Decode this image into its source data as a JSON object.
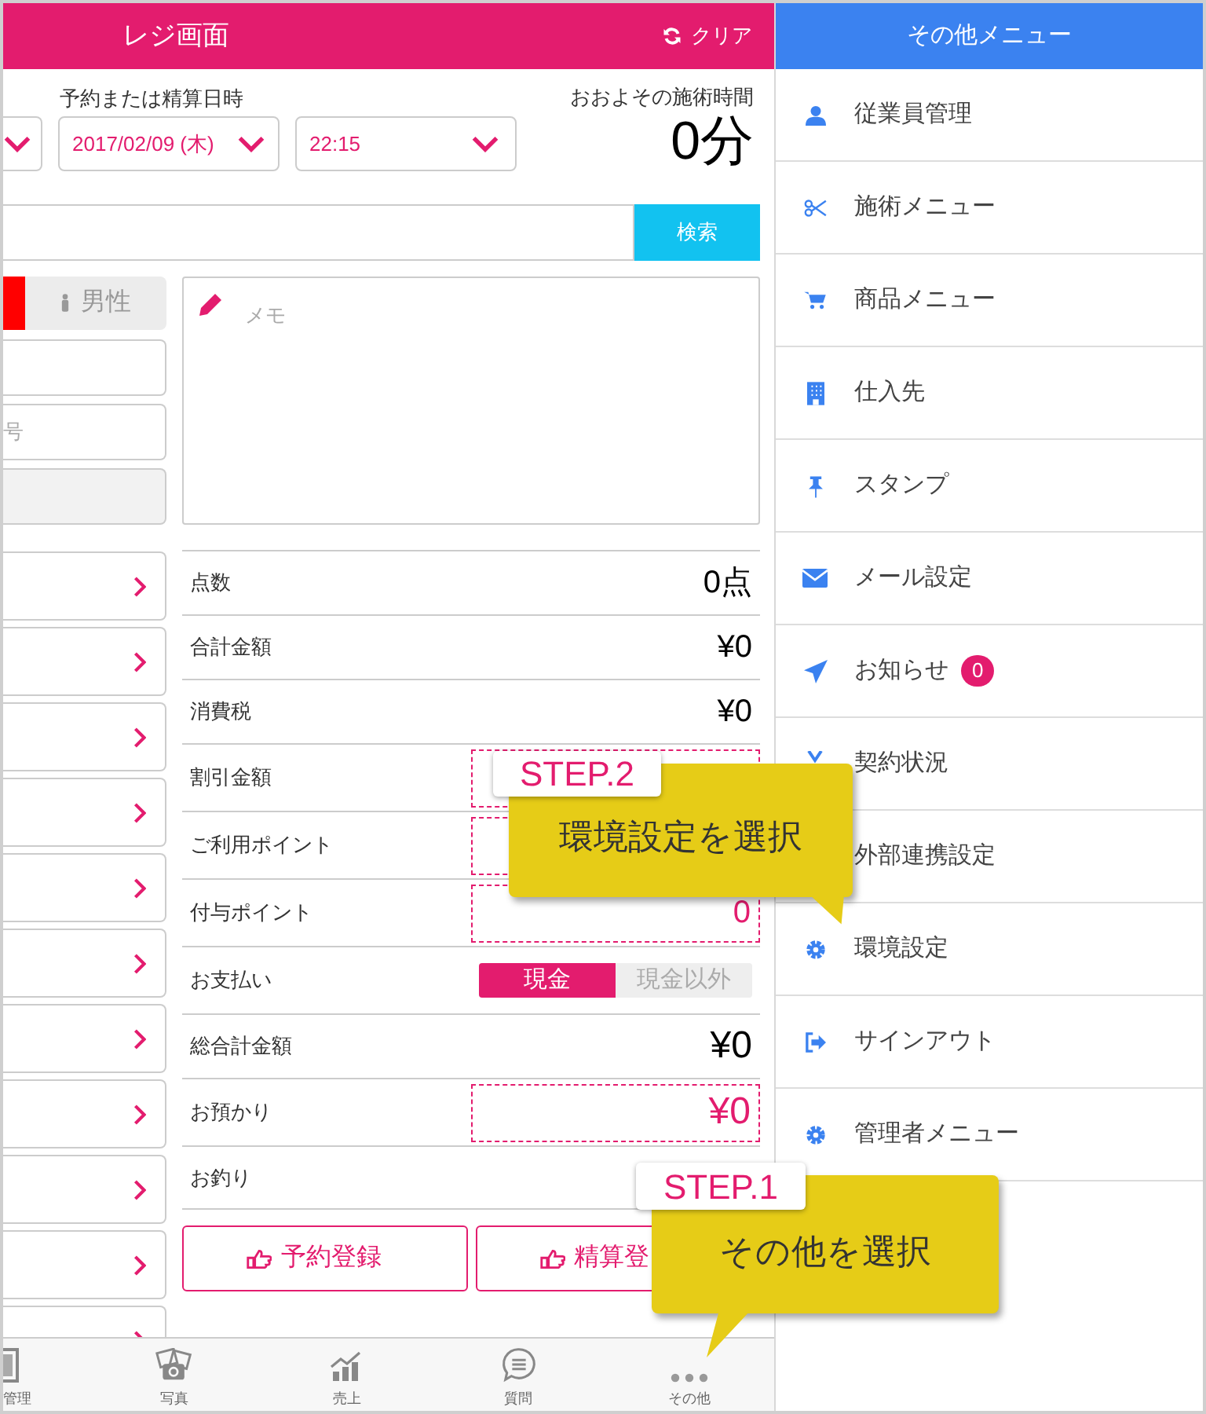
{
  "register": {
    "title": "レジ画面",
    "clear_button": "クリア",
    "date_label": "予約または精算日時",
    "date_value": "2017/02/09 (木)",
    "time_value": "22:15",
    "duration_label": "おおよその施術時間",
    "duration_value": "0分",
    "search_button": "検索",
    "gender_toggle": [
      {
        "selected": true
      },
      {
        "label": "男性",
        "selected": false
      }
    ],
    "number_placeholder": "号",
    "memo_placeholder": "メモ",
    "summary": [
      {
        "label": "点数",
        "value": "0点",
        "kind": "plain"
      },
      {
        "label": "合計金額",
        "value": "¥0",
        "kind": "plain"
      },
      {
        "label": "消費税",
        "value": "¥0",
        "kind": "plain"
      },
      {
        "label": "割引金額",
        "kind": "input"
      },
      {
        "label": "ご利用ポイント",
        "kind": "input"
      },
      {
        "label": "付与ポイント",
        "value": "0",
        "kind": "input"
      },
      {
        "label": "お支払い",
        "kind": "toggle",
        "options": [
          {
            "label": "現金",
            "selected": true
          },
          {
            "label": "現金以外",
            "selected": false
          }
        ]
      },
      {
        "label": "総合計金額",
        "value": "¥0",
        "kind": "total"
      },
      {
        "label": "お預かり",
        "value": "¥0",
        "kind": "input_large"
      },
      {
        "label": "お釣り",
        "kind": "plain"
      }
    ],
    "actions": [
      "予約登録",
      "精算登"
    ],
    "tab_bar": [
      {
        "label": "管理"
      },
      {
        "label": "写真"
      },
      {
        "label": "売上"
      },
      {
        "label": "質問"
      },
      {
        "label": "その他"
      }
    ]
  },
  "other_menu": {
    "title": "その他メニュー",
    "items": [
      {
        "label": "従業員管理"
      },
      {
        "label": "施術メニュー"
      },
      {
        "label": "商品メニュー"
      },
      {
        "label": "仕入先"
      },
      {
        "label": "スタンプ"
      },
      {
        "label": "メール設定"
      },
      {
        "label": "お知らせ",
        "badge": "0"
      },
      {
        "label": "契約状況"
      },
      {
        "label": "外部連携設定"
      },
      {
        "label": "環境設定"
      },
      {
        "label": "サインアウト"
      },
      {
        "label": "管理者メニュー"
      }
    ]
  },
  "callouts": [
    {
      "step": "STEP.2",
      "text": "環境設定を選択"
    },
    {
      "step": "STEP.1",
      "text": "その他を選択"
    }
  ]
}
